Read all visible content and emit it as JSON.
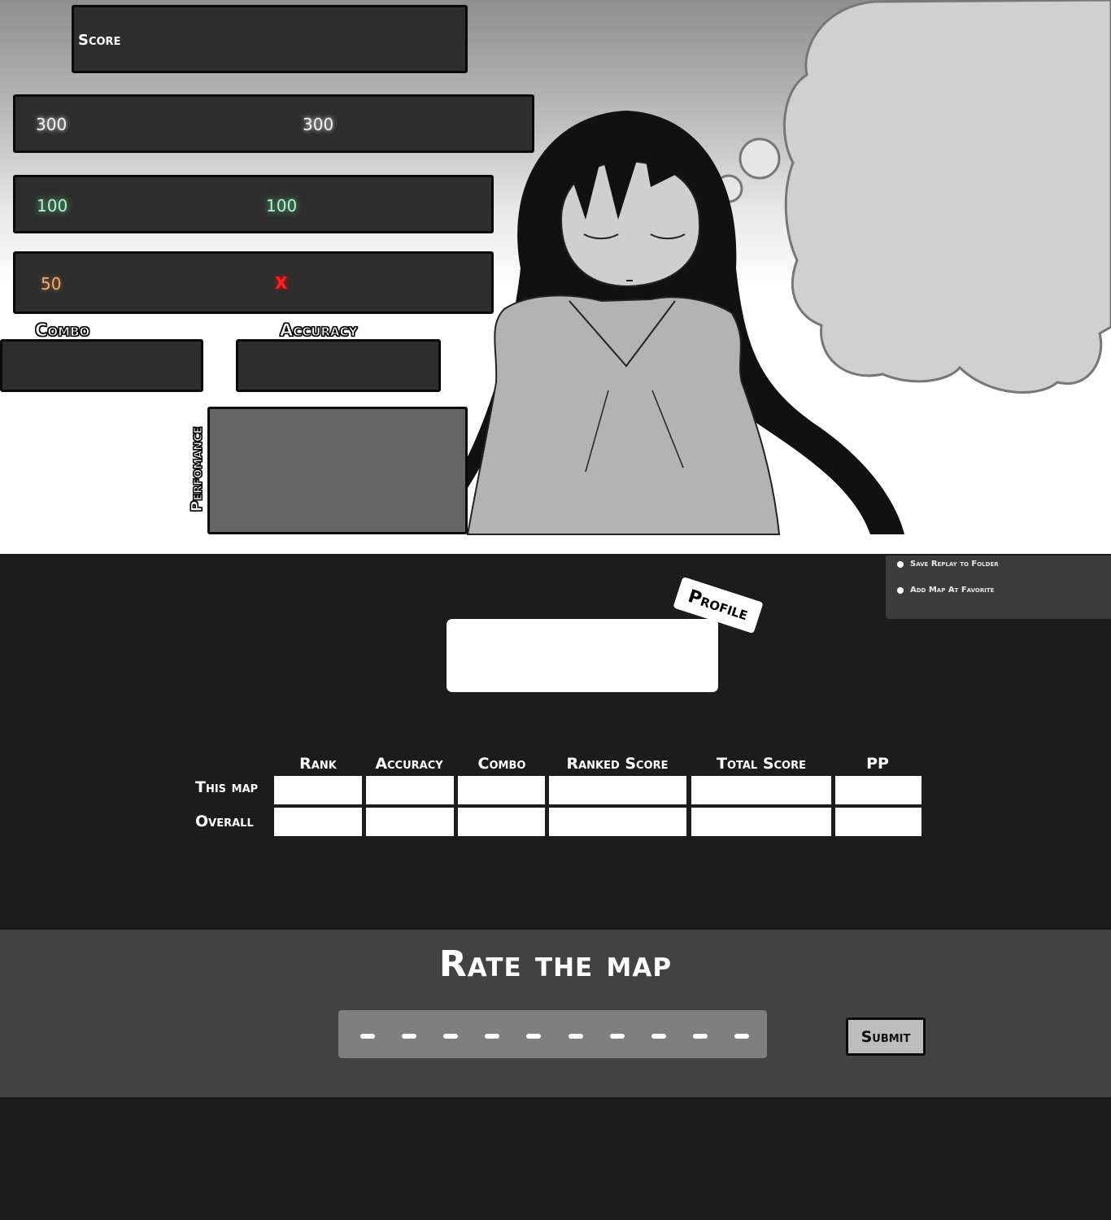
{
  "score_panel": {
    "score_label": "Score",
    "judgements": {
      "count_300_label": "300",
      "count_300_geki": "300",
      "count_100_label": "100",
      "count_100_katu": "100",
      "count_50_label": "50",
      "miss_label": "X"
    },
    "combo_label": "Combo",
    "accuracy_label": "Accuracy",
    "performance_label": "Perfomance"
  },
  "options_menu": {
    "items": [
      {
        "label": "Save Replay to Folder"
      },
      {
        "label": "Add Map At Favorite"
      }
    ]
  },
  "profile": {
    "tag_label": "Profile"
  },
  "stats_table": {
    "columns": [
      "Rank",
      "Accuracy",
      "Combo",
      "Ranked Score",
      "Total Score",
      "PP"
    ],
    "rows": [
      "This map",
      "Overall"
    ]
  },
  "rating": {
    "title": "Rate the map",
    "submit_label": "Submit",
    "steps": 10,
    "selected": 0
  },
  "colors": {
    "panel_dark": "#2e2e2e",
    "page_bg": "#1c1c1c",
    "rate_bg": "#424242",
    "hit_300": "#f2f2f2",
    "hit_100": "#5fe39a",
    "hit_50": "#e8b07a",
    "miss": "#ff2020"
  }
}
